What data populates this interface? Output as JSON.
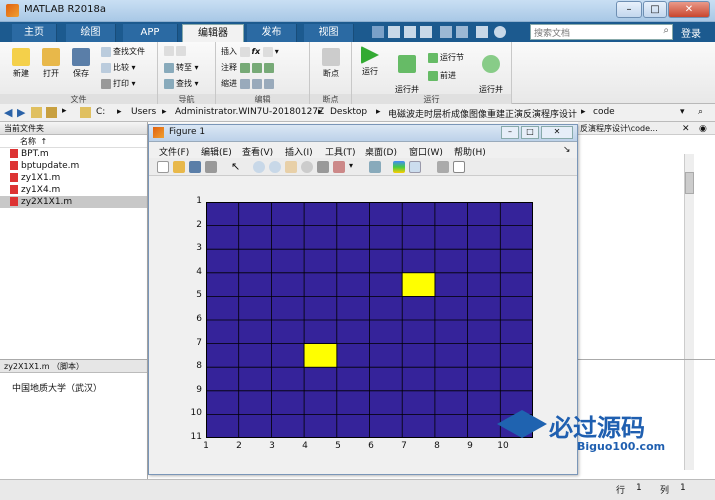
{
  "window": {
    "title": "MATLAB R2018a",
    "min_label": "–",
    "max_label": "□",
    "close_label": "✕"
  },
  "tabs": [
    {
      "label": "主页"
    },
    {
      "label": "绘图"
    },
    {
      "label": "APP"
    },
    {
      "label": "编辑器"
    },
    {
      "label": "发布"
    },
    {
      "label": "视图"
    }
  ],
  "search": {
    "placeholder": "搜索文档",
    "login": "登录"
  },
  "ribbon": {
    "file": {
      "group": "文件",
      "new": "新建",
      "open": "打开",
      "save": "保存",
      "find": "查找文件",
      "compare": "比较",
      "print": "打印"
    },
    "nav": {
      "group": "导航",
      "goto": "转至",
      "find": "查找"
    },
    "edit": {
      "group": "编辑",
      "insert": "插入",
      "comment": "注释",
      "indent": "缩进",
      "fx": "fx"
    },
    "breakpoints": {
      "group": "断点",
      "label": "断点"
    },
    "run": {
      "group": "运行",
      "run": "运行",
      "run_advance": "运行并\n前进",
      "run_section": "运行节",
      "advance": "前进",
      "run_time": "运行并\n计时"
    }
  },
  "address": {
    "parts": [
      "C:",
      "Users",
      "Administrator.WIN7U-20180127Z",
      "Desktop",
      "电磁波走时层析成像图像重建正演反演程序设计",
      "code"
    ]
  },
  "current_folder": {
    "header": "当前文件夹",
    "column": "名称",
    "column_sort": "↑",
    "files": [
      {
        "name": "BPT.m"
      },
      {
        "name": "bptupdate.m"
      },
      {
        "name": "zy1X1.m"
      },
      {
        "name": "zy1X4.m"
      },
      {
        "name": "zy2X1X1.m",
        "selected": true
      }
    ]
  },
  "details": {
    "title": "zy2X1X1.m （脚本）",
    "text": "中国地质大学（武汉）"
  },
  "right_pane": {
    "path": "反演程序设计\\code..."
  },
  "figure": {
    "title": "Figure 1",
    "menu": [
      "文件(F)",
      "编辑(E)",
      "查看(V)",
      "插入(I)",
      "工具(T)",
      "桌面(D)",
      "窗口(W)",
      "帮助(H)"
    ]
  },
  "chart_data": {
    "type": "heatmap",
    "title": "",
    "xlabel": "",
    "ylabel": "",
    "x_ticks": [
      1,
      2,
      3,
      4,
      5,
      6,
      7,
      8,
      9,
      10
    ],
    "y_ticks": [
      1,
      2,
      3,
      4,
      5,
      6,
      7,
      8,
      9,
      10,
      11
    ],
    "xlim": [
      1,
      10
    ],
    "ylim": [
      1,
      11
    ],
    "y_reversed": true,
    "cols": 10,
    "rows": 10,
    "background_color": "#35239a",
    "highlight_color": "#ffff00",
    "highlight_cells": [
      {
        "x": 7,
        "y": 4
      },
      {
        "x": 4,
        "y": 7
      }
    ]
  },
  "status": {
    "row_label": "行",
    "row": "1",
    "col_label": "列",
    "col": "1"
  },
  "watermark": {
    "text": "必过源码",
    "url": "Biguo100.com"
  }
}
